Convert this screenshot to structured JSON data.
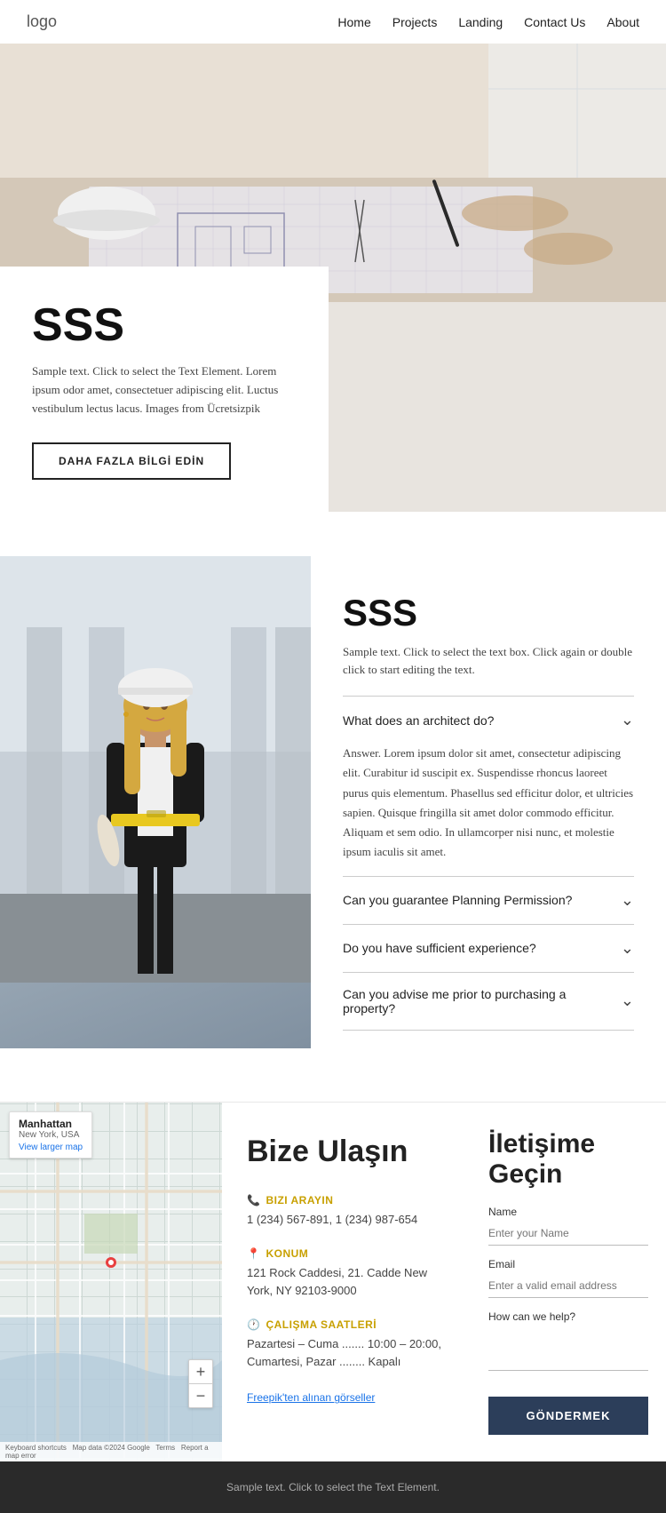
{
  "nav": {
    "logo": "logo",
    "links": [
      {
        "label": "Home",
        "href": "#"
      },
      {
        "label": "Projects",
        "href": "#"
      },
      {
        "label": "Landing",
        "href": "#"
      },
      {
        "label": "Contact Us",
        "href": "#"
      },
      {
        "label": "About",
        "href": "#"
      }
    ]
  },
  "intro": {
    "heading": "SSS",
    "body": "Sample text. Click to select the Text Element. Lorem ipsum odor amet, consectetuer adipiscing elit. Luctus vestibulum lectus lacus. Images from Ücretsizpik",
    "cta_label": "DAHA FAZLA BİLGİ EDİN"
  },
  "faq": {
    "heading": "SSS",
    "subtitle": "Sample text. Click to select the text box. Click again or double click to start editing the text.",
    "items": [
      {
        "question": "What does an architect do?",
        "answer": "Answer. Lorem ipsum dolor sit amet, consectetur adipiscing elit. Curabitur id suscipit ex. Suspendisse rhoncus laoreet purus quis elementum. Phasellus sed efficitur dolor, et ultricies sapien. Quisque fringilla sit amet dolor commodo efficitur. Aliquam et sem odio. In ullamcorper nisi nunc, et molestie ipsum iaculis sit amet.",
        "open": true
      },
      {
        "question": "Can you guarantee Planning Permission?",
        "answer": "",
        "open": false
      },
      {
        "question": "Do you have sufficient experience?",
        "answer": "",
        "open": false
      },
      {
        "question": "Can you advise me prior to purchasing a property?",
        "answer": "",
        "open": false
      }
    ]
  },
  "contact": {
    "map": {
      "city": "Manhattan",
      "state": "New York, USA",
      "view_larger_label": "View larger map",
      "zoom_in": "+",
      "zoom_out": "−",
      "footer_text": "Keyboard shortcuts   Map data ©2024 Google   Terms   Report a map error"
    },
    "heading": "Bize Ulaşın",
    "blocks": [
      {
        "icon": "📞",
        "label": "BIZI ARAYIN",
        "lines": [
          "1 (234) 567-891, 1 (234) 987-654"
        ]
      },
      {
        "icon": "📍",
        "label": "KONUM",
        "lines": [
          "121 Rock Caddesi, 21. Cadde New York, NY 92103-9000"
        ]
      },
      {
        "icon": "🕐",
        "label": "ÇALIŞMA SAATLERİ",
        "lines": [
          "Pazartesi – Cuma ....... 10:00 – 20:00,",
          "Cumartesi, Pazar ........ Kapalı"
        ]
      }
    ],
    "freepik_note": "Freepik'ten alınan görseller"
  },
  "form": {
    "heading": "İletişime Geçin",
    "fields": [
      {
        "label": "Name",
        "placeholder": "Enter your Name",
        "type": "text",
        "name": "name"
      },
      {
        "label": "Email",
        "placeholder": "Enter a valid email address",
        "type": "email",
        "name": "email"
      },
      {
        "label": "How can we help?",
        "placeholder": "",
        "type": "textarea",
        "name": "message"
      }
    ],
    "submit_label": "GÖNDERMEK"
  },
  "footer": {
    "text": "Sample text. Click to select the Text Element."
  }
}
